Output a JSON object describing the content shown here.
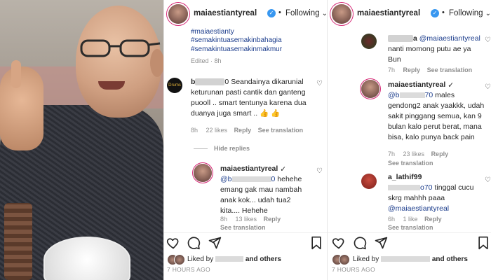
{
  "left_panel": {
    "header": {
      "username": "maiaestiantyreal",
      "separator": "•",
      "follow": "Following"
    },
    "caption_tags": [
      "#maiaestianty",
      "#semakintuasemakinbahagia",
      "#semakintuasemakinmakmur"
    ],
    "edited": "Edited · 8h",
    "comment1": {
      "username": "b",
      "username_tail": "0",
      "text_line1": "Seandainya",
      "text_rest": "dikarunial keturunan pasti cantik dan ganteng puooll .. smart tentunya karena dua duanya juga smart .. 👍 👍",
      "time": "8h",
      "likes": "22 likes",
      "reply": "Reply",
      "translation": "See translation"
    },
    "hide_replies": "Hide replies",
    "reply1": {
      "username": "maiaestiantyreal",
      "mention_start": "@b",
      "mention_end": "0",
      "text": "hehehe emang gak mau nambah anak kok... udah tua2 kita.... Hehehe",
      "time": "8h",
      "likes": "13 likes",
      "reply": "Reply",
      "translation": "See translation"
    },
    "footer": {
      "liked_by": "Liked by",
      "and_others": "and others",
      "ago": "7 HOURS AGO"
    }
  },
  "right_panel": {
    "header": {
      "username": "maiaestiantyreal",
      "separator": "•",
      "follow": "Following"
    },
    "comment0": {
      "username_tail": "a",
      "mention": "@maiaestiantyreal",
      "text": "nanti momong putu ae ya Bun",
      "time": "7h",
      "reply": "Reply",
      "translation": "See translation"
    },
    "reply2": {
      "username": "maiaestiantyreal",
      "mention_start": "@b",
      "mention_end": "70",
      "text": "males gendong2 anak yaakkk, udah sakit pinggang semua, kan 9 bulan kalo perut berat, mana bisa, kalo punya back pain",
      "time": "7h",
      "likes": "23 likes",
      "reply": "Reply",
      "translation": "See translation"
    },
    "comment3": {
      "username": "a_lathif99",
      "mention_end": "o70",
      "text1": "tinggal cucu skrg mahhh paaa",
      "mention2": "@maiaestiantyreal",
      "time": "6h",
      "likes": "1 like",
      "reply": "Reply",
      "translation": "See translation"
    },
    "footer": {
      "liked_by": "Liked by",
      "and_others": "and others",
      "ago": "7 HOURS AGO"
    }
  },
  "icons": [
    "heart-icon",
    "comment-icon",
    "share-icon",
    "bookmark-icon",
    "verified-icon"
  ],
  "colors": {
    "link": "#1c3d8c",
    "verified": "#3897f0",
    "muted": "#8e8e8e"
  }
}
